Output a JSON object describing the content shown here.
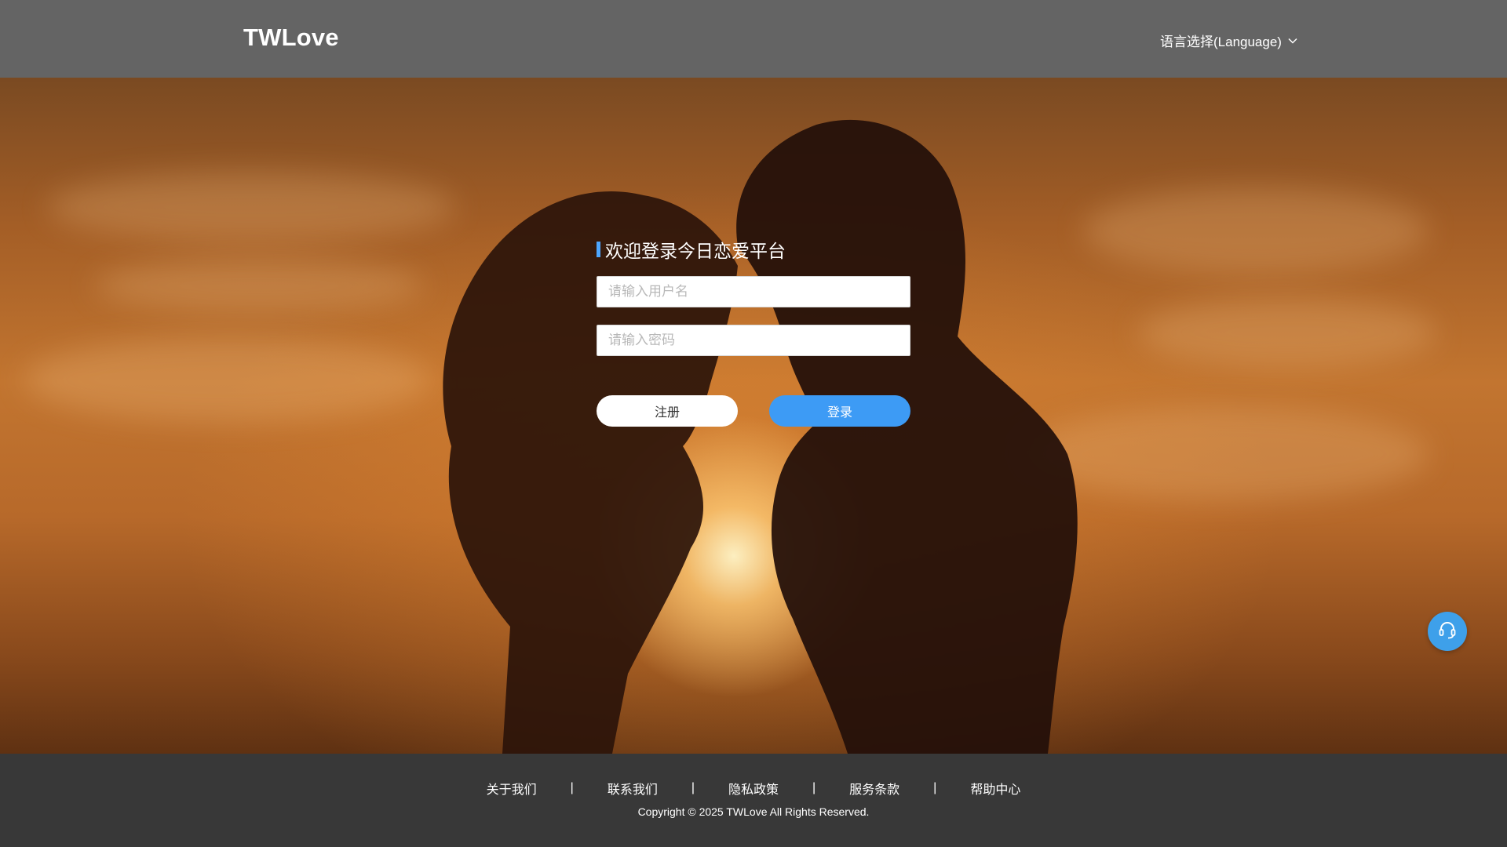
{
  "header": {
    "logo": "TWLove",
    "language_label": "语言选择(Language)"
  },
  "login": {
    "title": "欢迎登录今日恋爱平台",
    "username_placeholder": "请输入用户名",
    "password_placeholder": "请输入密码",
    "register_label": "注册",
    "login_label": "登录"
  },
  "footer": {
    "links": [
      "关于我们",
      "联系我们",
      "隐私政策",
      "服务条款",
      "帮助中心"
    ],
    "separator": "|",
    "copyright": "Copyright © 2025 TWLove All Rights Reserved."
  },
  "support": {
    "icon": "headset-icon"
  },
  "colors": {
    "header_bg": "#646464",
    "footer_bg": "#383838",
    "accent": "#3d9bf5",
    "support_bg": "#3ea0ea"
  }
}
